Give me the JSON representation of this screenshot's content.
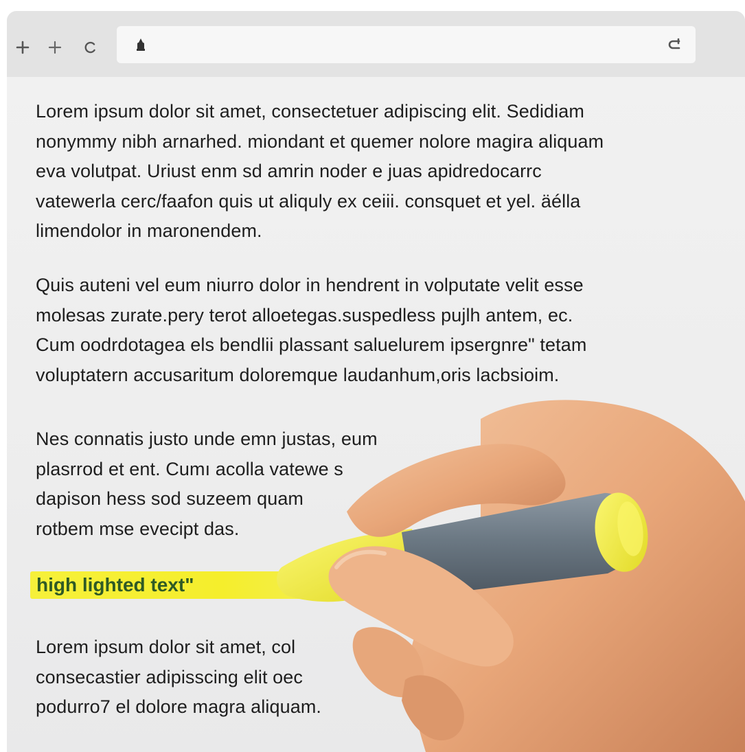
{
  "browser": {
    "toolbar_icons": [
      "plus-icon",
      "plus-icon",
      "reload-icon"
    ],
    "address_bar": {
      "lock_icon": "lock-icon",
      "reload_icon": "reload-icon"
    }
  },
  "document": {
    "paragraph_1": "Lorem ipsum dolor sit amet, consectetuer adipiscing elit. Sedidiam\nnonymmy nibh arnarhed. miondant et quemer nolore magira aliquam\neva volutpat. Uriust enm sd amrin noder e juas apidredocarrc\nvatewerla cerc/faafon quis ut aliquly ex ceiii. consquet et yel. äélla\nlimendolor in maronendem.",
    "paragraph_2": "Quis auteni vel eum niurro dolor in hendrent in volputate velit esse\nmolesas zurate.pery terot alloetegas.suspedless pujlh antem, ec.\nCum oodrdotagea els bendlii plassant saluelurem ipsergnre\" tetam\nvoluptatern accusaritum doloremque laudanhum,oris lacbsioim.",
    "paragraph_3": "Nes connatis justo unde emn justas, eum\nplasrrod et ent. Cumı acolla vatewe s\ndapison hess sod suzeem quam\nrotbem mse evecipt das.",
    "highlighted": "high lighted text\"",
    "paragraph_5": "Lorem ipsum dolor sit amet, col\nconsecastier adipisscing elit oec\npodurro7 el dolore magra aliquam."
  },
  "colors": {
    "highlight": "#f5ee2c",
    "highlight_text": "#2f5a25",
    "marker_body": "#6c7a86",
    "marker_cap": "#f3ee3a",
    "skin": "#e9a97a"
  }
}
